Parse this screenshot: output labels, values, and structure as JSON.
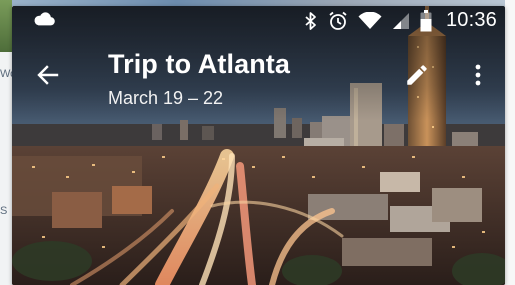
{
  "statusbar": {
    "time": "10:36",
    "icons": [
      "cloud-icon",
      "bluetooth-icon",
      "alarm-icon",
      "wifi-icon",
      "cellular-signal-icon",
      "battery-icon"
    ]
  },
  "toolbar": {
    "title": "Trip to Atlanta",
    "subtitle": "March 19 – 22",
    "back_icon": "arrow-back-icon",
    "edit_icon": "pencil-icon",
    "more_icon": "more-vert-icon"
  },
  "colors": {
    "text_on_image": "#ffffff",
    "city_lights": "#f2a65a",
    "sky_top": "#2b3442",
    "sky_horizon": "#5a5d63"
  },
  "background_fragments": [
    "Wo",
    "S"
  ]
}
